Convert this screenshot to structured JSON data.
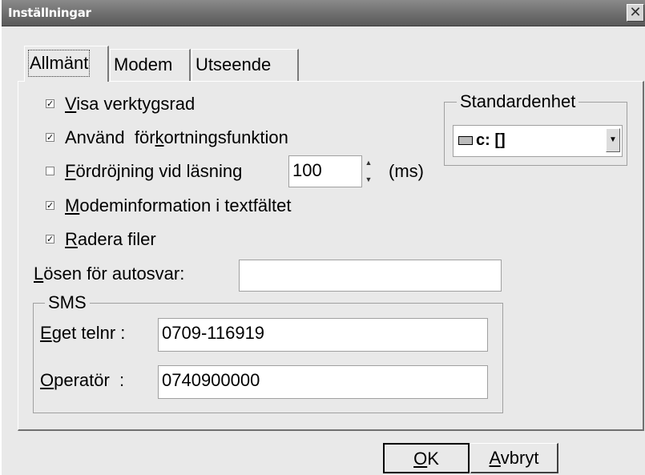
{
  "window": {
    "title": "Inställningar",
    "close_glyph": "✕"
  },
  "tabs": [
    {
      "label": "Allmänt"
    },
    {
      "label": "Modem"
    },
    {
      "label": "Utseende"
    }
  ],
  "options": {
    "visa": {
      "mnemonic": "V",
      "rest": "isa verktygsrad",
      "checked": true
    },
    "anvand": {
      "pre": "Använd  för",
      "mnemonic": "k",
      "rest": "ortningsfunktion",
      "checked": true
    },
    "fordrojning": {
      "mnemonic": "F",
      "rest": "ördröjning vid läsning",
      "checked": false,
      "value": "100",
      "unit": "(ms)"
    },
    "modeminfo": {
      "mnemonic": "M",
      "rest": "odeminformation i textfältet",
      "checked": true
    },
    "radera": {
      "mnemonic": "R",
      "rest": "adera filer",
      "checked": true
    }
  },
  "check_glyph": "✓",
  "autosvar": {
    "mnemonic": "L",
    "rest": "ösen för autosvar:",
    "value": ""
  },
  "standard": {
    "title": "Standardenhet",
    "value": "c: []",
    "icon": "drive-icon"
  },
  "sms": {
    "title": "SMS",
    "telnr": {
      "mnemonic": "E",
      "rest": "get telnr :",
      "value": "0709-116919"
    },
    "operator": {
      "mnemonic": "O",
      "rest": "peratör  :",
      "value": "0740900000"
    }
  },
  "buttons": {
    "ok": {
      "mnemonic": "O",
      "rest": "K"
    },
    "cancel": {
      "mnemonic": "A",
      "rest": "vbryt"
    }
  }
}
